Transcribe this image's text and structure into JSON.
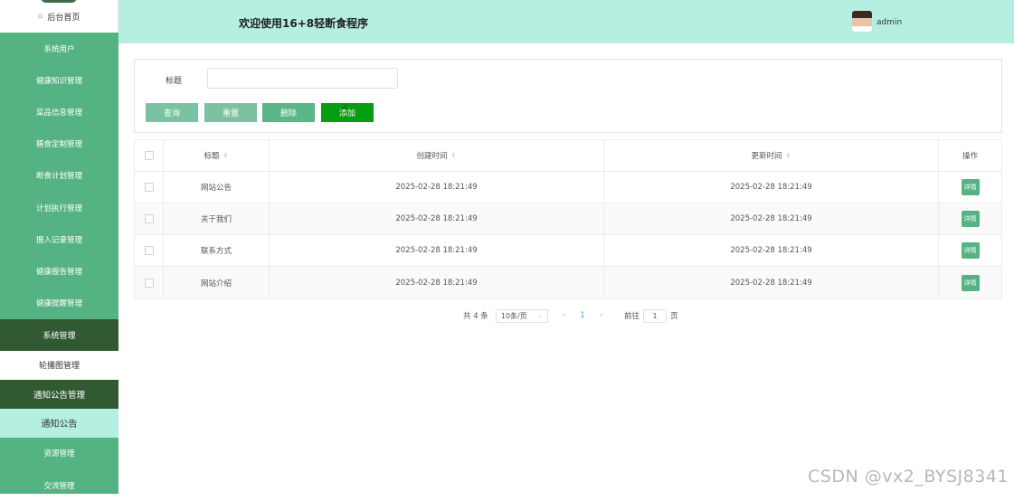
{
  "sidebar": {
    "home": "后台首页",
    "items": [
      {
        "label": "系统用户",
        "style": "normal"
      },
      {
        "label": "健康知识管理",
        "style": "normal"
      },
      {
        "label": "菜品信息管理",
        "style": "normal"
      },
      {
        "label": "膳食定制管理",
        "style": "normal"
      },
      {
        "label": "断食计划管理",
        "style": "normal"
      },
      {
        "label": "计划执行管理",
        "style": "normal"
      },
      {
        "label": "摄入记录管理",
        "style": "normal"
      },
      {
        "label": "健康报告管理",
        "style": "normal"
      },
      {
        "label": "健康提醒管理",
        "style": "normal"
      },
      {
        "label": "系统管理",
        "style": "dark"
      },
      {
        "label": "轮播图管理",
        "style": "white"
      },
      {
        "label": "通知公告管理",
        "style": "dark2"
      },
      {
        "label": "通知公告",
        "style": "light"
      },
      {
        "label": "资源管理",
        "style": "normal"
      },
      {
        "label": "交流管理",
        "style": "normal"
      }
    ]
  },
  "header": {
    "title": "欢迎使用16+8轻断食程序",
    "user": "admin"
  },
  "search": {
    "label": "标题",
    "value": "",
    "buttons": {
      "query": "查询",
      "reset": "重置",
      "delete": "删除",
      "add": "添加"
    }
  },
  "table": {
    "columns": {
      "title": "标题",
      "created": "创建时间",
      "updated": "更新时间",
      "action": "操作"
    },
    "rows": [
      {
        "title": "网站公告",
        "created": "2025-02-28 18:21:49",
        "updated": "2025-02-28 18:21:49",
        "action": "详情"
      },
      {
        "title": "关于我们",
        "created": "2025-02-28 18:21:49",
        "updated": "2025-02-28 18:21:49",
        "action": "详情"
      },
      {
        "title": "联系方式",
        "created": "2025-02-28 18:21:49",
        "updated": "2025-02-28 18:21:49",
        "action": "详情"
      },
      {
        "title": "网站介绍",
        "created": "2025-02-28 18:21:49",
        "updated": "2025-02-28 18:21:49",
        "action": "详情"
      }
    ]
  },
  "pagination": {
    "total": "共 4 条",
    "page_size": "10条/页",
    "current_page": "1",
    "goto_prefix": "前往",
    "goto_value": "1",
    "goto_suffix": "页"
  },
  "watermark": "CSDN @vx2_BYSJ8341",
  "colors": {
    "primary": "#55b383",
    "dark": "#315a33",
    "header": "#b4efe2",
    "add": "#069d10"
  }
}
